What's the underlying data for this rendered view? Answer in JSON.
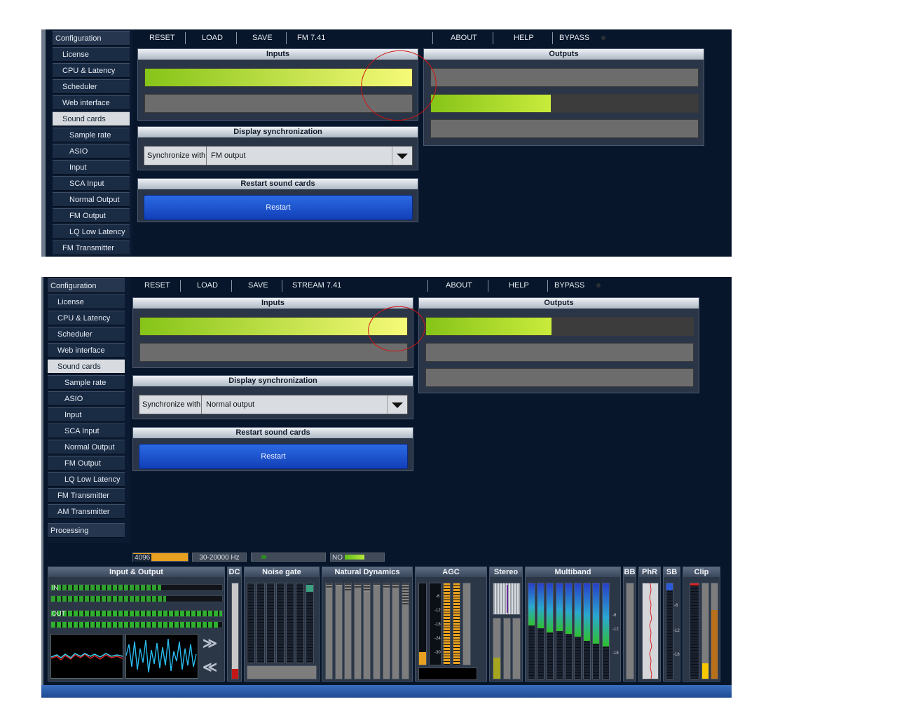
{
  "top": {
    "sidebar": [
      "Configuration",
      "License",
      "CPU & Latency",
      "Scheduler",
      "Web interface",
      "Sound cards",
      "Sample rate",
      "ASIO",
      "Input",
      "SCA Input",
      "Normal Output",
      "FM Output",
      "LQ Low Latency",
      "FM Transmitter"
    ],
    "toolbar": {
      "reset": "RESET",
      "load": "LOAD",
      "save": "SAVE",
      "version": "FM 7.41",
      "about": "ABOUT",
      "help": "HELP",
      "bypass": "BYPASS"
    },
    "inputs_title": "Inputs",
    "outputs_title": "Outputs",
    "display_sync_title": "Display synchronization",
    "sync_label": "Synchronize with",
    "sync_value": "FM output",
    "restart_title": "Restart sound cards",
    "restart_button": "Restart",
    "levels": {
      "input_1": 1.0,
      "output_2": 0.45
    }
  },
  "bottom": {
    "sidebar": [
      "Configuration",
      "License",
      "CPU & Latency",
      "Scheduler",
      "Web interface",
      "Sound cards",
      "Sample rate",
      "ASIO",
      "Input",
      "SCA Input",
      "Normal Output",
      "FM Output",
      "LQ Low Latency",
      "FM Transmitter",
      "AM Transmitter"
    ],
    "processing": "Processing",
    "toolbar": {
      "reset": "RESET",
      "load": "LOAD",
      "save": "SAVE",
      "version": "STREAM 7.41",
      "about": "ABOUT",
      "help": "HELP",
      "bypass": "BYPASS"
    },
    "inputs_title": "Inputs",
    "outputs_title": "Outputs",
    "display_sync_title": "Display synchronization",
    "sync_label": "Synchronize with",
    "sync_value": "Normal output",
    "restart_title": "Restart sound cards",
    "restart_button": "Restart",
    "levels": {
      "input_1": 1.0,
      "output_1": 0.47
    },
    "status": {
      "buffer": "4096",
      "range": "30-20000 Hz",
      "nf": "NO"
    },
    "meters": {
      "io": "Input & Output",
      "in": "IN",
      "out": "OUT",
      "dc": "DC",
      "noise_gate": "Noise gate",
      "natural_dynamics": "Natural Dynamics",
      "agc": "AGC",
      "stereo": "Stereo",
      "multiband": "Multiband",
      "bb": "BB",
      "phr": "PhR",
      "sb": "SB",
      "clip": "Clip"
    },
    "ticks": {
      "m6": "-6",
      "m12": "-12",
      "m18": "-18",
      "m24": "-24",
      "m30": "-30"
    }
  },
  "colors": {
    "background": "#07162a",
    "panel_title": "#c8d0da",
    "level_green": "#86c418",
    "level_yellow": "#f6fa78",
    "restart_blue": "#1f55d0",
    "annotation_red": "#d41414"
  },
  "icons": {
    "arrow_right": "≫",
    "arrow_left": "≪",
    "dropdown": "chevron-down-icon",
    "bypass_led": "status-led-icon"
  }
}
